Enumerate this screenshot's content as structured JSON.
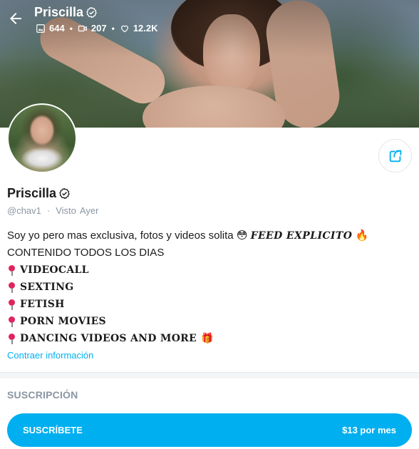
{
  "header": {
    "name": "Priscilla",
    "stats": {
      "photos": "644",
      "videos": "207",
      "likes": "12.2K"
    }
  },
  "profile": {
    "name": "Priscilla",
    "handle": "@chav1",
    "separator": "·",
    "seen_label": "Visto",
    "seen_value": "Ayer"
  },
  "bio": {
    "intro_text": "Soy yo pero mas exclusiva, fotos y videos solita",
    "emoji_flushed": "😳",
    "explicit_text": "𝑭𝑬𝑬𝑫 𝑬𝑿𝑷𝑳𝑰𝑪𝑰𝑻𝑶",
    "emoji_fire": "🔥",
    "tail_text": "CONTENIDO TODOS LOS DIAS",
    "items": [
      "VIDEOCALL",
      "SEXTING",
      "FETISH",
      "PORN MOVIES",
      "DANCING VIDEOS AND MORE"
    ],
    "last_item_emoji": "🎁"
  },
  "collapse_link": "Contraer información",
  "subscription": {
    "title": "Suscripción",
    "button_label": "SUSCRÍBETE",
    "price": "$13 por mes"
  },
  "colors": {
    "accent": "#00aff0",
    "muted": "#8a96a3",
    "pin": "#e0245e"
  },
  "icons": {
    "back": "arrow-left-icon",
    "verified": "verified-check-icon",
    "photos": "image-icon",
    "videos": "video-icon",
    "likes": "heart-icon",
    "share": "share-icon"
  }
}
